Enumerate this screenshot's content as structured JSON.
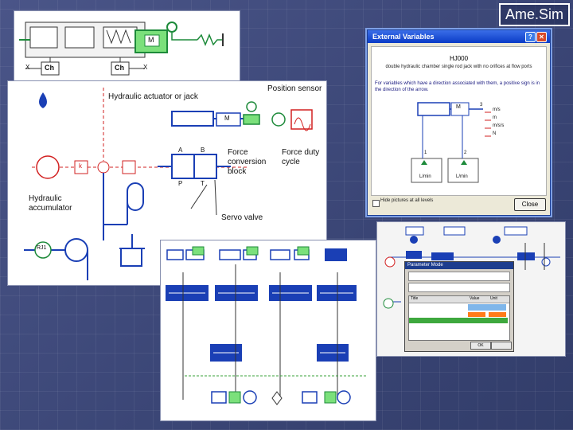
{
  "title": "Ame.Sim",
  "main_diagram": {
    "labels": {
      "position_sensor": "Position sensor",
      "actuator": "Hydraulic actuator or jack",
      "force_block": "Force\nconversion\nblock",
      "duty_cycle": "Force duty\ncycle",
      "accumulator": "Hydraulic\naccumulator",
      "servo_valve": "Servo valve",
      "port_a": "A",
      "port_b": "B",
      "port_p": "P",
      "port_t": "T",
      "m_label": "M",
      "k_label": "k",
      "flow_source": "RJ1"
    }
  },
  "top_strip": {
    "c_left": "Ch",
    "c_right": "Ch",
    "x_left": "X",
    "x_right": "X",
    "m_label": "M"
  },
  "dialog": {
    "title": "External Variables",
    "component": "HJ000",
    "description": "double hydraulic chamber single rod jack with no orifices at flow ports",
    "note": "For variables which have a direction associated with them, a positive sign is in the direction of the arrow.",
    "units": [
      "m/s",
      "m",
      "m/s/s",
      "N"
    ],
    "port_labels": [
      "1",
      "2",
      "3"
    ],
    "flow_units": [
      "L/min",
      "L/min"
    ],
    "checkbox_label": "Hide pictures at all levels",
    "close_label": "Close",
    "m_label": "M"
  },
  "param_window": {
    "title": "Parameter Mode",
    "columns": [
      "Title",
      "Value",
      "Unit"
    ]
  },
  "colors": {
    "accent_blue": "#1a3fb5",
    "sensor_green": "#1d8a3a",
    "signal_red": "#d22020"
  }
}
